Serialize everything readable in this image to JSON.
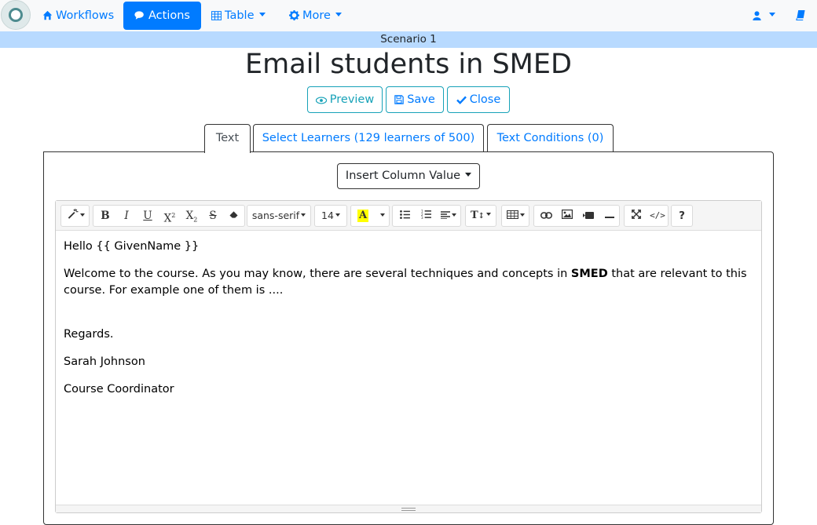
{
  "nav": {
    "items": [
      {
        "label": "Workflows",
        "icon": "home-icon"
      },
      {
        "label": "Actions",
        "icon": "comments-icon"
      },
      {
        "label": "Table",
        "icon": "table-icon"
      },
      {
        "label": "More",
        "icon": "gear-icon"
      }
    ],
    "user_icon": "user-icon",
    "book_icon": "book-icon"
  },
  "scenario": "Scenario 1",
  "title": "Email students in SMED",
  "buttons": {
    "preview": "Preview",
    "save": "Save",
    "close": "Close"
  },
  "tabs": [
    {
      "label": "Text"
    },
    {
      "label": "Select Learners (129 learners of 500)"
    },
    {
      "label": "Text Conditions (0)"
    }
  ],
  "insert_column": "Insert Column Value",
  "toolbar": {
    "font_family": "sans-serif",
    "font_size": "14"
  },
  "content": {
    "greeting": "Hello {{ GivenName }}",
    "body_before": "Welcome to the course. As you may know, there are several techniques and concepts in ",
    "body_bold": "SMED",
    "body_after": " that are relevant to this course. For example one of them is ....",
    "regards": "Regards.",
    "name": "Sarah Johnson",
    "role": "Course Coordinator"
  },
  "colors": {
    "primary": "#007bff",
    "info": "#17a2b8",
    "scenario_bg": "#b8daff",
    "navbar_bg": "#f8f9fa"
  }
}
